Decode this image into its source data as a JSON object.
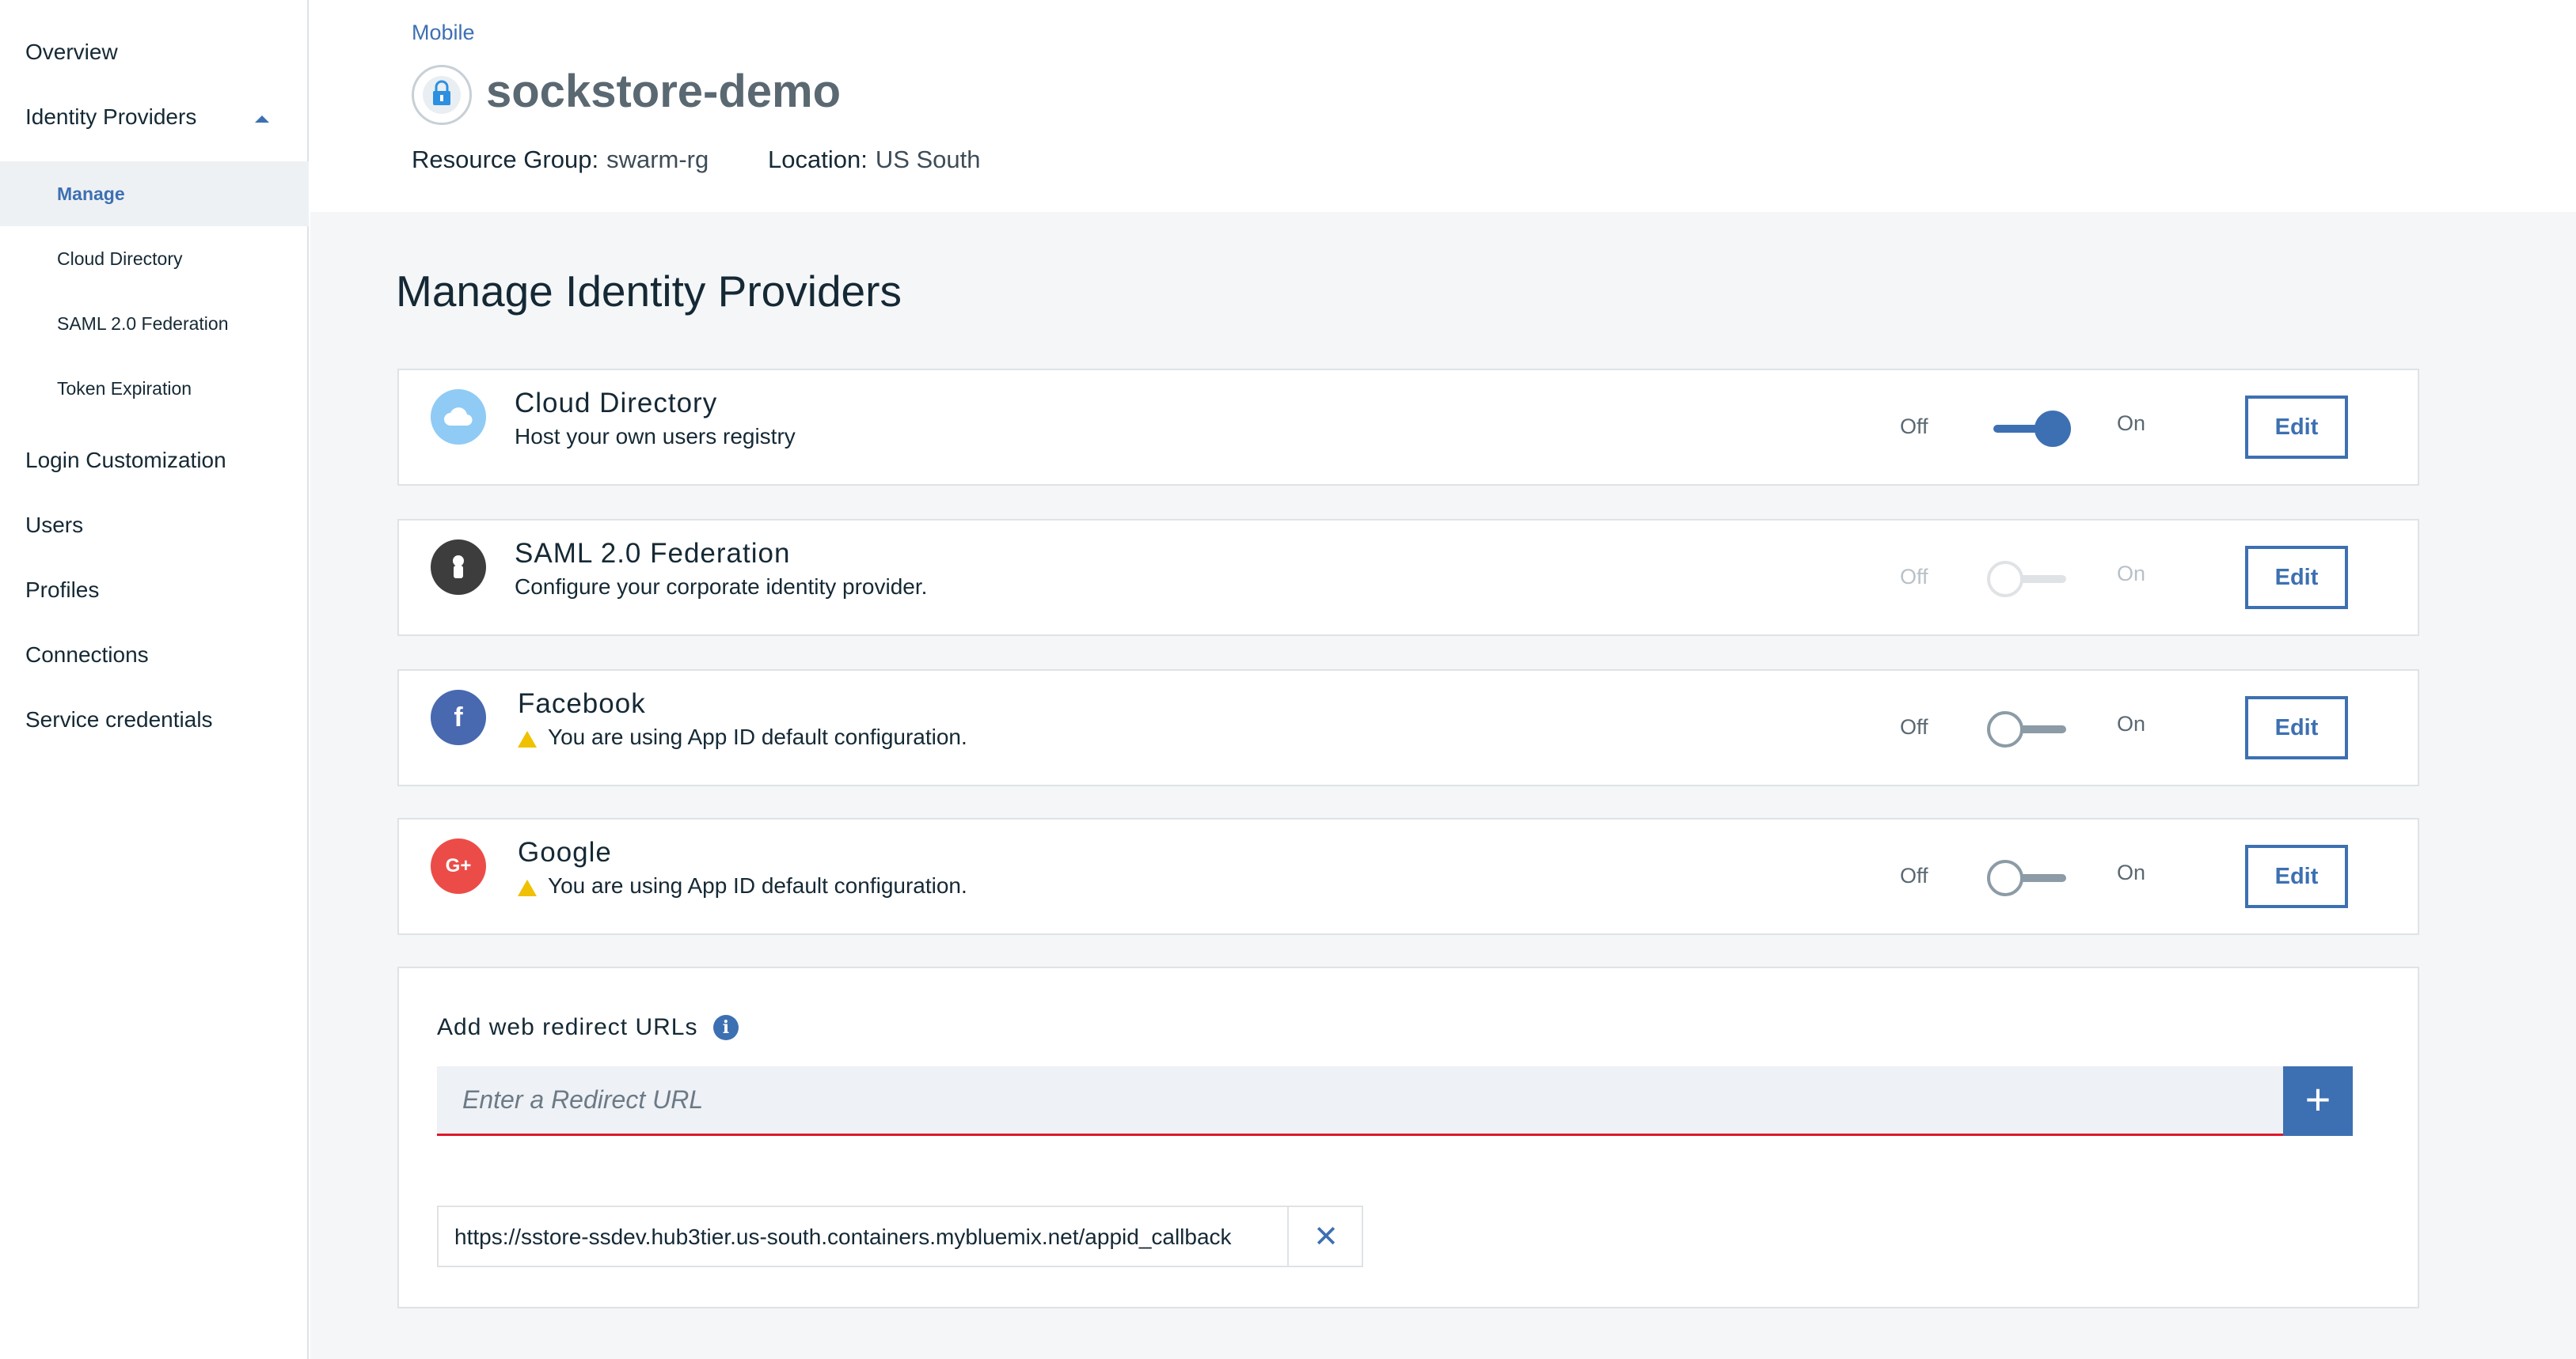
{
  "sidebar": {
    "overview": "Overview",
    "identity_providers": "Identity Providers",
    "sub": {
      "manage": "Manage",
      "cloud_directory": "Cloud Directory",
      "saml": "SAML 2.0 Federation",
      "token_expiration": "Token Expiration"
    },
    "login_customization": "Login Customization",
    "users": "Users",
    "profiles": "Profiles",
    "connections": "Connections",
    "service_credentials": "Service credentials"
  },
  "header": {
    "breadcrumb": "Mobile",
    "title": "sockstore-demo",
    "resource_group_label": "Resource Group:",
    "resource_group_value": "swarm-rg",
    "location_label": "Location:",
    "location_value": "US South"
  },
  "main": {
    "title": "Manage Identity Providers",
    "off_label": "Off",
    "on_label": "On",
    "edit_label": "Edit",
    "providers": [
      {
        "name": "Cloud Directory",
        "description": "Host your own users registry",
        "icon": "cloud-icon",
        "state": "on"
      },
      {
        "name": "SAML 2.0 Federation",
        "description": "Configure your corporate identity provider.",
        "icon": "user-icon",
        "state": "disabled"
      },
      {
        "name": "Facebook",
        "description": "You are using App ID default configuration.",
        "icon": "facebook-icon",
        "state": "off",
        "warning": true
      },
      {
        "name": "Google",
        "description": "You are using App ID default configuration.",
        "icon": "google-plus-icon",
        "state": "off",
        "warning": true
      }
    ],
    "redirect": {
      "title": "Add web redirect URLs",
      "placeholder": "Enter a Redirect URL",
      "urls": [
        "https://sstore-ssdev.hub3tier.us-south.containers.mybluemix.net/appid_callback"
      ]
    }
  },
  "colors": {
    "accent": "#3d70b2",
    "warning": "#efc100",
    "error_underline": "#e0182d",
    "cloud_icon": "#8fcbf5",
    "saml_icon": "#3d3d3d",
    "facebook_icon": "#4868b0",
    "google_icon": "#ec4c47"
  }
}
